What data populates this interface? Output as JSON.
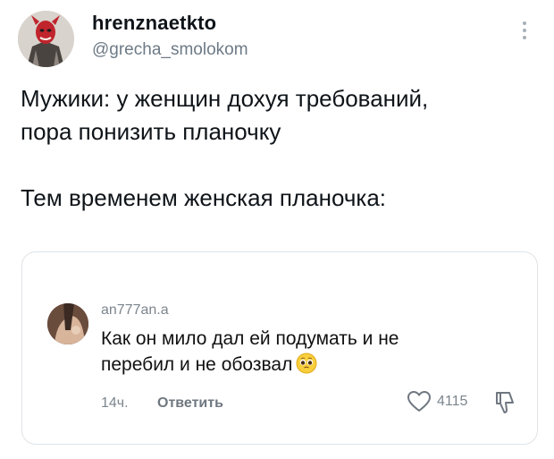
{
  "author": {
    "display_name": "hrenznaetkto",
    "handle": "@grecha_smolokom"
  },
  "tweet": {
    "text": "Мужики: у женщин дохуя требований,\nпора понизить планочку\n\nТем временем женская планочка:"
  },
  "quote": {
    "username": "an777an.a",
    "text": "Как он мило дал ей подумать и не\nперебил и не обозвал",
    "time": "14ч.",
    "reply_label": "Ответить",
    "like_count": "4115"
  },
  "icons": {
    "more": "more-vertical-icon",
    "like": "heart-icon",
    "dislike": "thumbs-down-icon",
    "emoji": "pleading-face-emoji"
  },
  "colors": {
    "secondary_text": "#6d7a86",
    "border": "#dfe3e7"
  }
}
